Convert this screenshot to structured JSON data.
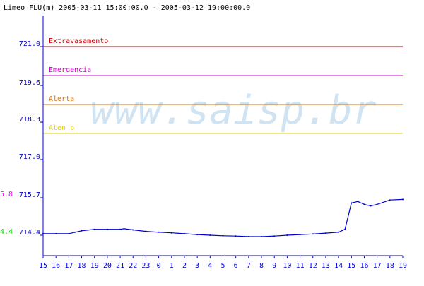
{
  "header": {
    "title": "Limeo FLU(m) 2005-03-11 15:00:00.0 - 2005-03-12 19:00:00.0"
  },
  "watermark": {
    "text": "www.saisp.br",
    "color": "#cfe3f3"
  },
  "colors": {
    "background": "#ffffff",
    "axis": "#0000cc",
    "series": "#0000cc",
    "current_value": "#ff00ff",
    "start_value": "#00cc00"
  },
  "chart_data": {
    "type": "line",
    "title": "Limeo FLU(m) 2005-03-11 15:00:00.0 - 2005-03-12 19:00:00.0",
    "xlabel": "",
    "ylabel": "",
    "ylim": [
      713.8,
      722.0
    ],
    "grid": false,
    "x_tick_labels": [
      "15",
      "16",
      "17",
      "18",
      "19",
      "20",
      "21",
      "22",
      "23",
      "0",
      "1",
      "2",
      "3",
      "4",
      "5",
      "6",
      "7",
      "8",
      "9",
      "10",
      "11",
      "12",
      "13",
      "14",
      "15",
      "16",
      "17",
      "18",
      "19"
    ],
    "y_tick_labels": [
      "721.0",
      "719.6",
      "718.3",
      "717.0",
      "715.7",
      "714.4"
    ],
    "thresholds": [
      {
        "label": "Extravasamento",
        "value": 721.0,
        "color": "#cc0000"
      },
      {
        "label": "Emergencia",
        "value": 720.0,
        "color": "#cc00cc"
      },
      {
        "label": "Alerta",
        "value": 719.0,
        "color": "#e07000"
      },
      {
        "label": "Aten  o",
        "value": 718.0,
        "color": "#e8d000"
      }
    ],
    "markers": {
      "current": {
        "label": "5.8",
        "value": 715.8
      },
      "start": {
        "label": "4.4",
        "value": 714.4
      }
    },
    "series": [
      {
        "color": "#0000cc",
        "x": [
          0,
          1,
          2,
          2.5,
          3,
          4,
          5,
          6,
          6.3,
          7,
          8,
          9,
          10,
          11,
          12,
          13,
          14,
          15,
          16,
          17,
          18,
          19,
          20,
          21,
          22,
          23,
          23.5,
          24,
          24.5,
          25,
          25.5,
          26,
          27,
          28
        ],
        "values": [
          714.55,
          714.55,
          714.55,
          714.6,
          714.65,
          714.7,
          714.7,
          714.7,
          714.72,
          714.68,
          714.63,
          714.6,
          714.58,
          714.55,
          714.52,
          714.5,
          714.48,
          714.47,
          714.45,
          714.45,
          714.47,
          714.5,
          714.52,
          714.54,
          714.57,
          714.6,
          714.7,
          715.6,
          715.65,
          715.55,
          715.5,
          715.55,
          715.7,
          715.72
        ]
      }
    ]
  }
}
